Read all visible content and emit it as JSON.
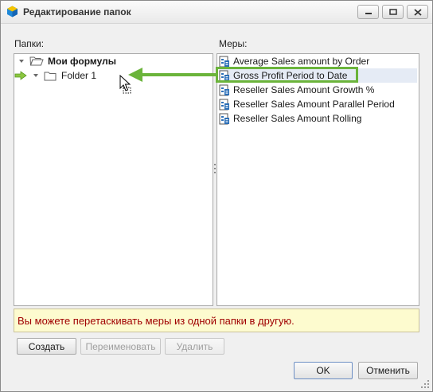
{
  "window": {
    "title": "Редактирование папок"
  },
  "folders_panel": {
    "label": "Папки:",
    "root": "Мои формулы",
    "children": [
      "Folder 1"
    ]
  },
  "measures_panel": {
    "label": "Меры:",
    "items": [
      "Average Sales amount by Order",
      "Gross Profit Period to Date",
      "Reseller Sales Amount Growth %",
      "Reseller Sales Amount Parallel Period",
      "Reseller Sales Amount Rolling"
    ],
    "highlighted_index": 1
  },
  "hint": "Вы можете перетаскивать меры из одной папки в другую.",
  "buttons": {
    "create": "Создать",
    "rename": "Переименовать",
    "delete": "Удалить",
    "ok": "OK",
    "cancel": "Отменить"
  },
  "colors": {
    "hint_text": "#a00000",
    "hint_bg": "#fdfbcf",
    "callout": "#6bb43b",
    "arrow": "#6bb43b"
  }
}
